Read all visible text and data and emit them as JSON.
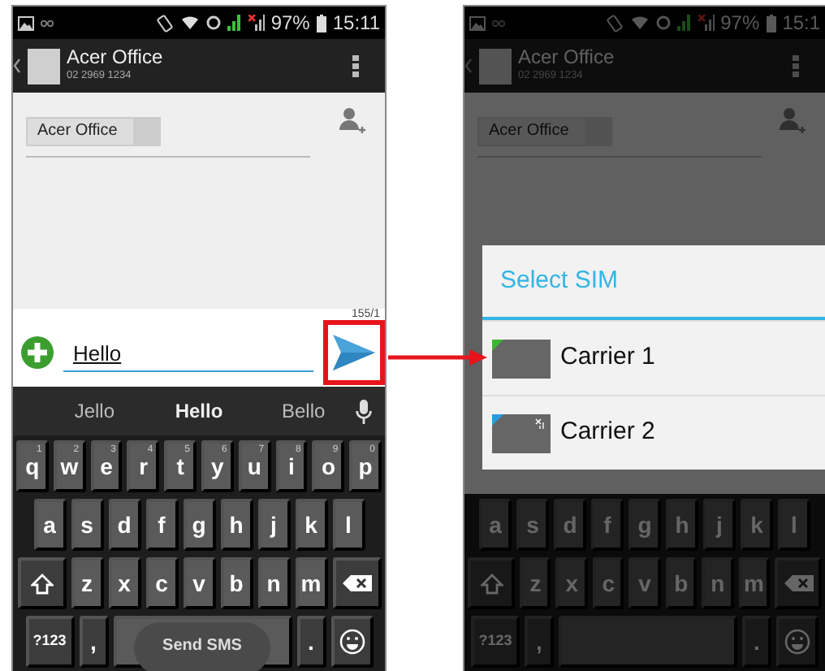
{
  "phones": [
    {
      "kind": "compose",
      "dimmed": false,
      "status": {
        "battery": "97%",
        "time": "15:11"
      },
      "header": {
        "name": "Acer Office",
        "number": "02 2969 1234"
      },
      "recipient": "Acer Office",
      "counter": "155/1",
      "message": "Hello",
      "send_highlighted": true,
      "suggestions": [
        {
          "label": "Jello",
          "selected": false
        },
        {
          "label": "Hello",
          "selected": true
        },
        {
          "label": "Bello",
          "selected": false
        }
      ],
      "keyboard": {
        "rows": [
          {
            "keys": [
              {
                "label": "q",
                "hint": "1"
              },
              {
                "label": "w",
                "hint": "2"
              },
              {
                "label": "e",
                "hint": "3"
              },
              {
                "label": "r",
                "hint": "4"
              },
              {
                "label": "t",
                "hint": "5"
              },
              {
                "label": "y",
                "hint": "6"
              },
              {
                "label": "u",
                "hint": "7"
              },
              {
                "label": "i",
                "hint": "8"
              },
              {
                "label": "o",
                "hint": "9"
              },
              {
                "label": "p",
                "hint": "0"
              }
            ]
          },
          {
            "keys": [
              {
                "label": "a"
              },
              {
                "label": "s"
              },
              {
                "label": "d"
              },
              {
                "label": "f"
              },
              {
                "label": "g"
              },
              {
                "label": "h"
              },
              {
                "label": "j"
              },
              {
                "label": "k"
              },
              {
                "label": "l"
              }
            ]
          },
          {
            "keys": [
              {
                "label": "z"
              },
              {
                "label": "x"
              },
              {
                "label": "c"
              },
              {
                "label": "v"
              },
              {
                "label": "b"
              },
              {
                "label": "n"
              },
              {
                "label": "m"
              }
            ]
          }
        ],
        "symbols": "?123",
        "comma": ",",
        "period": ".",
        "space_hint": "Send SMS"
      }
    },
    {
      "kind": "sim_picker",
      "dimmed": true,
      "status": {
        "battery": "97%",
        "time": "15:1"
      },
      "header": {
        "name": "Acer Office",
        "number": "02 2969 1234"
      },
      "recipient": "Acer Office",
      "keyboard": {
        "rows": [
          {
            "keys": [
              {
                "label": "a"
              },
              {
                "label": "s"
              },
              {
                "label": "d"
              },
              {
                "label": "f"
              },
              {
                "label": "g"
              },
              {
                "label": "h"
              },
              {
                "label": "j"
              },
              {
                "label": "k"
              },
              {
                "label": "l"
              }
            ]
          },
          {
            "keys": [
              {
                "label": "z"
              },
              {
                "label": "x"
              },
              {
                "label": "c"
              },
              {
                "label": "v"
              },
              {
                "label": "b"
              },
              {
                "label": "n"
              },
              {
                "label": "m"
              }
            ]
          }
        ],
        "symbols": "?123",
        "comma": ",",
        "period": "."
      },
      "dialog": {
        "title": "Select SIM",
        "options": [
          {
            "label": "Carrier 1",
            "color": "#3cb531"
          },
          {
            "label": "Carrier 2",
            "color": "#2a9be0"
          }
        ]
      }
    }
  ]
}
